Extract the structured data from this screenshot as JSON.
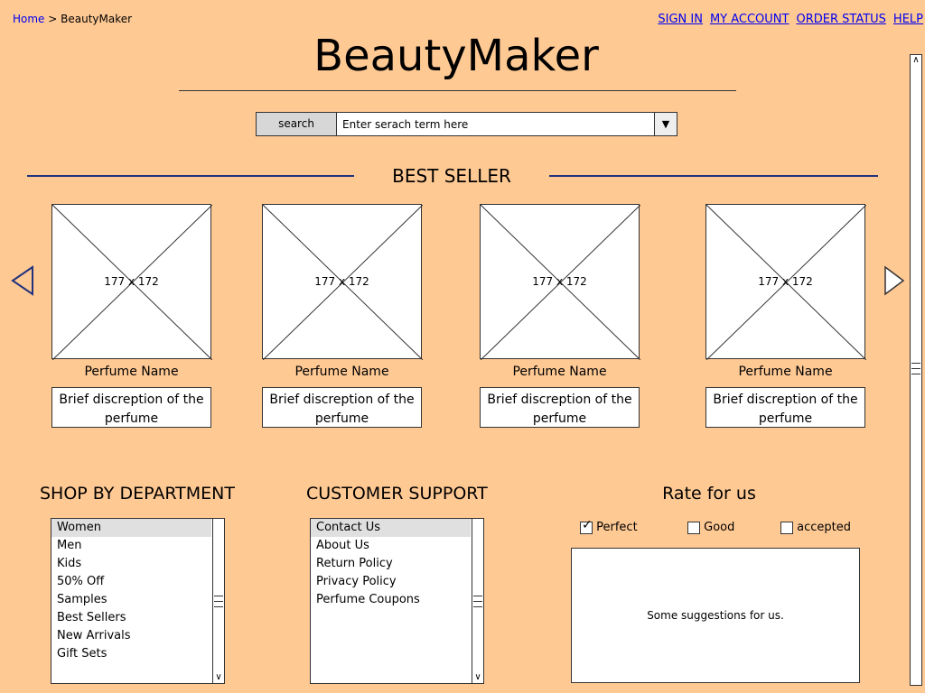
{
  "breadcrumb": {
    "home": "Home",
    "separator": ">",
    "current": "BeautyMaker"
  },
  "topnav": {
    "sign_in": "SIGN IN",
    "my_account": "MY ACCOUNT",
    "order_status": "ORDER STATUS",
    "help": "HELP"
  },
  "site_title": "BeautyMaker",
  "search": {
    "button_label": "search",
    "value": "Enter serach term here"
  },
  "best_seller": {
    "title": "BEST SELLER",
    "products": [
      {
        "image_label": "177 x 172",
        "name": "Perfume Name",
        "description": "Brief discreption of the perfume"
      },
      {
        "image_label": "177 x 172",
        "name": "Perfume Name",
        "description": "Brief discreption of the perfume"
      },
      {
        "image_label": "177 x 172",
        "name": "Perfume Name",
        "description": "Brief discreption of the perfume"
      },
      {
        "image_label": "177 x 172",
        "name": "Perfume Name",
        "description": "Brief discreption of the perfume"
      }
    ]
  },
  "shop_by_department": {
    "title": "SHOP BY DEPARTMENT",
    "items": [
      "Women",
      "Men",
      "Kids",
      "50% Off",
      "Samples",
      "Best Sellers",
      "New Arrivals",
      "Gift Sets"
    ],
    "selected": "Women"
  },
  "customer_support": {
    "title": "CUSTOMER SUPPORT",
    "items": [
      "Contact Us",
      "About Us",
      "Return Policy",
      "Privacy Policy",
      "Perfume Coupons"
    ],
    "selected": "Contact Us"
  },
  "rate": {
    "title": "Rate for us",
    "options": [
      {
        "label": "Perfect",
        "checked": true
      },
      {
        "label": "Good",
        "checked": false
      },
      {
        "label": "accepted",
        "checked": false
      }
    ],
    "suggestions": "Some suggestions for us."
  },
  "colors": {
    "background": "#ffc994",
    "rule": "#22327d",
    "link": "#0000ee"
  }
}
